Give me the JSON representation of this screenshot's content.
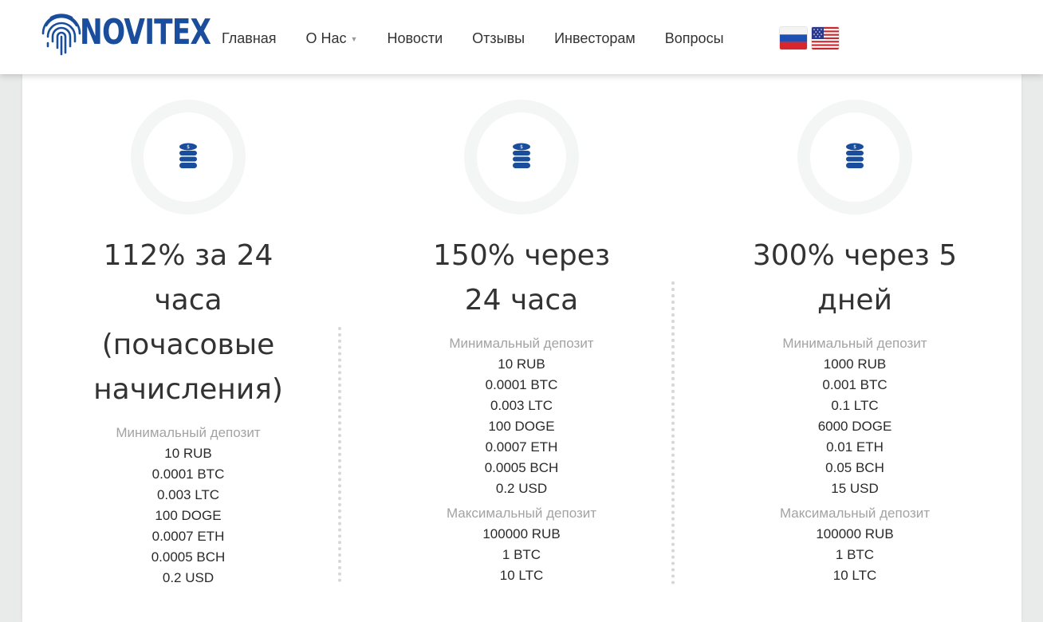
{
  "brand": {
    "name": "NOVITEX",
    "color": "#1a4e9c"
  },
  "nav": {
    "items": [
      {
        "label": "Главная"
      },
      {
        "label": "О Нас"
      },
      {
        "label": "Новости"
      },
      {
        "label": "Отзывы"
      },
      {
        "label": "Инвесторам"
      },
      {
        "label": "Вопросы"
      }
    ],
    "flags": [
      "russia-flag-icon",
      "usa-flag-icon"
    ]
  },
  "plans": [
    {
      "icon": "coins-stack-icon",
      "title_lines": [
        "112% за 24",
        "часа",
        "(почасовые",
        "начисления)"
      ],
      "min_label": "Минимальный депозит",
      "min_values": [
        "10 RUB",
        "0.0001 BTC",
        "0.003 LTC",
        "100 DOGE",
        "0.0007 ETH",
        "0.0005 BCH",
        "0.2 USD"
      ],
      "max_label": "",
      "max_values": []
    },
    {
      "icon": "coins-stack-icon",
      "title_lines": [
        "150% через",
        "24 часа"
      ],
      "min_label": "Минимальный депозит",
      "min_values": [
        "10 RUB",
        "0.0001 BTC",
        "0.003 LTC",
        "100 DOGE",
        "0.0007 ETH",
        "0.0005 BCH",
        "0.2 USD"
      ],
      "max_label": "Максимальный депозит",
      "max_values": [
        "100000 RUB",
        "1 BTC",
        "10 LTC"
      ]
    },
    {
      "icon": "coins-stack-icon",
      "title_lines": [
        "300% через 5",
        "дней"
      ],
      "min_label": "Минимальный депозит",
      "min_values": [
        "1000 RUB",
        "0.001 BTC",
        "0.1 LTC",
        "6000 DOGE",
        "0.01 ETH",
        "0.05 BCH",
        "15 USD"
      ],
      "max_label": "Максимальный депозит",
      "max_values": [
        "100000 RUB",
        "1 BTC",
        "10 LTC"
      ]
    }
  ]
}
